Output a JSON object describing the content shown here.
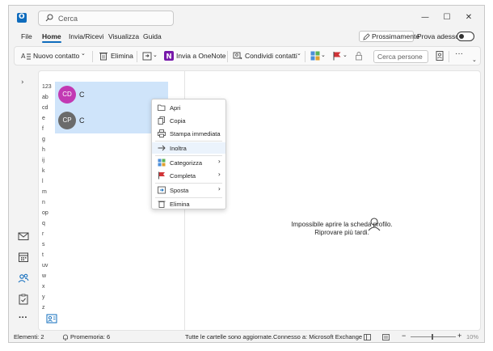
{
  "window": {
    "search_placeholder": "Cerca",
    "controls": {
      "minimize": "—",
      "maximize": "☐",
      "close": "✕"
    }
  },
  "menu": {
    "tabs": [
      "File",
      "Home",
      "Invia/Ricevi",
      "Visualizza",
      "Guida"
    ],
    "active_tab": "Home",
    "next_button": "Prossimamente",
    "try_label": "Prova adesso"
  },
  "ribbon": {
    "new_contact": "Nuovo contatto",
    "delete": "Elimina",
    "send_onenote": "Invia a OneNote",
    "share_contacts": "Condividi contatti",
    "search_people_placeholder": "Cerca persone",
    "more": "···"
  },
  "alphabet": [
    "123",
    "ab",
    "cd",
    "e",
    "f",
    "g",
    "h",
    "ij",
    "k",
    "l",
    "m",
    "n",
    "op",
    "q",
    "r",
    "s",
    "t",
    "uv",
    "w",
    "x",
    "y",
    "z"
  ],
  "contacts": [
    {
      "initials": "CD",
      "name": "C",
      "color": "#c239b3"
    },
    {
      "initials": "CP",
      "name": "C",
      "color": "#6b6b6b"
    }
  ],
  "context_menu": {
    "items": [
      {
        "label": "Apri",
        "icon": "open-icon"
      },
      {
        "label": "Copia",
        "icon": "copy-icon"
      },
      {
        "label": "Stampa immediata",
        "icon": "print-icon"
      },
      {
        "label": "Inoltra",
        "icon": "forward-icon"
      },
      {
        "label": "Categorizza",
        "icon": "categorize-icon"
      },
      {
        "label": "Completa",
        "icon": "flag-icon"
      },
      {
        "label": "Sposta",
        "icon": "move-icon"
      },
      {
        "label": "Elimina",
        "icon": "delete-icon"
      }
    ],
    "submenu_arrow": "›"
  },
  "reading_pane": {
    "line1": "Impossibile aprire la scheda profilo.",
    "line2": "Riprovare più tardi."
  },
  "status": {
    "items": "Elementi: 2",
    "reminder": "Promemoria: 6",
    "folders": "Tutte le cartelle sono aggiornate.",
    "connection": "Connesso a: Microsoft Exchange",
    "zoom": "10%"
  },
  "colors": {
    "accent": "#0f6cbd",
    "selection": "#cfe4fa",
    "onenote": "#7719aa",
    "flag": "#d13438"
  }
}
